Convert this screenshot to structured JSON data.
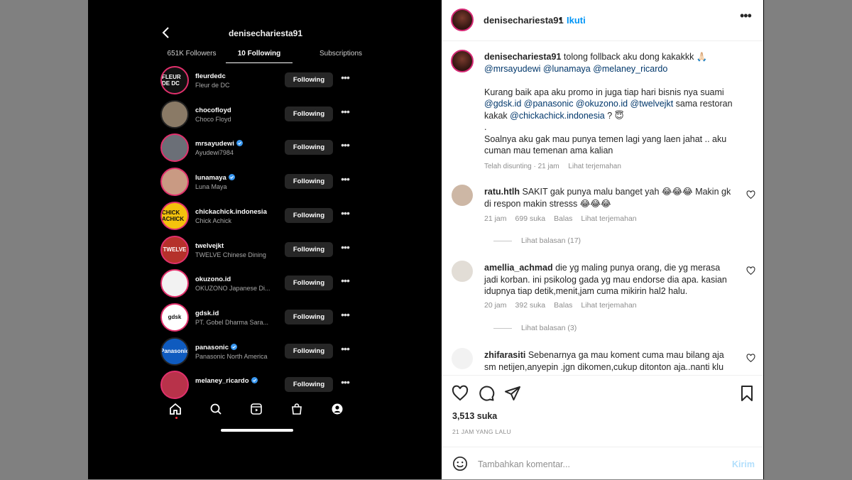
{
  "phone": {
    "username": "denisechariesta91",
    "tabs": [
      "651K Followers",
      "10 Following",
      "Subscriptions"
    ],
    "button_label": "Following",
    "more_glyph": "•••",
    "following": [
      {
        "handle": "fleurdedc",
        "name": "Fleur de DC",
        "verified": false,
        "avatar_text": "FLEUR DE DC",
        "avatar_bg": "#111111",
        "ring": true
      },
      {
        "handle": "chocofloyd",
        "name": "Choco Floyd",
        "verified": false,
        "avatar_text": "",
        "avatar_bg": "#8a7a66",
        "ring": false
      },
      {
        "handle": "mrsayudewi",
        "name": "Ayudewi7984",
        "verified": true,
        "avatar_text": "",
        "avatar_bg": "#6b6f77",
        "ring": true
      },
      {
        "handle": "lunamaya",
        "name": "Luna Maya",
        "verified": true,
        "avatar_text": "",
        "avatar_bg": "#c99a83",
        "ring": true
      },
      {
        "handle": "chickachick.indonesia",
        "name": "Chick Achick",
        "verified": false,
        "avatar_text": "CHICK ACHICK",
        "avatar_bg": "#f4c20d",
        "ring": true
      },
      {
        "handle": "twelvejkt",
        "name": "TWELVE Chinese Dining",
        "verified": false,
        "avatar_text": "TWELVE",
        "avatar_bg": "#b5312b",
        "ring": true
      },
      {
        "handle": "okuzono.id",
        "name": "OKUZONO Japanese Di...",
        "verified": false,
        "avatar_text": "",
        "avatar_bg": "#f2f2f2",
        "ring": true
      },
      {
        "handle": "gdsk.id",
        "name": "PT. Gobel Dharma Sara...",
        "verified": false,
        "avatar_text": "gdsk",
        "avatar_bg": "#ffffff",
        "ring": true
      },
      {
        "handle": "panasonic",
        "name": "Panasonic North America",
        "verified": true,
        "avatar_text": "Panasonic",
        "avatar_bg": "#0f5bbf",
        "ring": false
      },
      {
        "handle": "melaney_ricardo",
        "name": "",
        "verified": true,
        "avatar_text": "",
        "avatar_bg": "#b8324a",
        "ring": true
      }
    ]
  },
  "post": {
    "header": {
      "username": "denisechariesta91",
      "separator": "•",
      "follow_label": "Ikuti",
      "menu_glyph": "•••"
    },
    "caption": {
      "username": "denisechariesta91",
      "line1": "tolong follback aku dong kakakkk 🙏🏻",
      "mentions1": "@mrsayudewi @lunamaya @melaney_ricardo",
      "para2_a": "Kurang baik apa aku promo in juga tiap hari bisnis nya suami ",
      "para2_links": "@gdsk.id @panasonic @okuzono.id @twelvejkt",
      "para2_b": " sama restoran kakak ",
      "para2_link2": "@chickachick.indonesia",
      "para2_c": " ? 😇",
      "dot": ".",
      "para3": "Soalnya aku gak mau punya temen lagi yang laen jahat .. aku cuman mau temenan ama kalian",
      "meta_edited": "Telah disunting · 21 jam",
      "meta_translate": "Lihat terjemahan"
    },
    "comments": [
      {
        "user": "ratu.htlh",
        "text": "SAKIT gak punya malu banget yah 😂😂😂 Makin gk di respon makin stresss 😂😂😂",
        "time": "21 jam",
        "likes": "699 suka",
        "reply": "Balas",
        "translate": "Lihat terjemahan",
        "replies": "Lihat balasan (17)"
      },
      {
        "user": "amellia_achmad",
        "text": "die yg maling punya orang, die yg merasa jadi korban. ini psikolog gada yg mau endorse dia apa. kasian idupnya tiap detik,menit,jam cuma mikirin hal2 halu.",
        "time": "20 jam",
        "likes": "392 suka",
        "reply": "Balas",
        "translate": "Lihat terjemahan",
        "replies": "Lihat balasan (3)"
      },
      {
        "user": "zhifarasiti",
        "text": "Sebenarnya ga mau koment cuma mau bilang aja sm netijen,anyepin .jgn dikomen,cukup ditonton aja..nanti klu"
      }
    ],
    "likes": "3,513 suka",
    "time_ago": "21 JAM YANG LALU",
    "add_comment_placeholder": "Tambahkan komentar...",
    "post_label": "Kirim"
  }
}
